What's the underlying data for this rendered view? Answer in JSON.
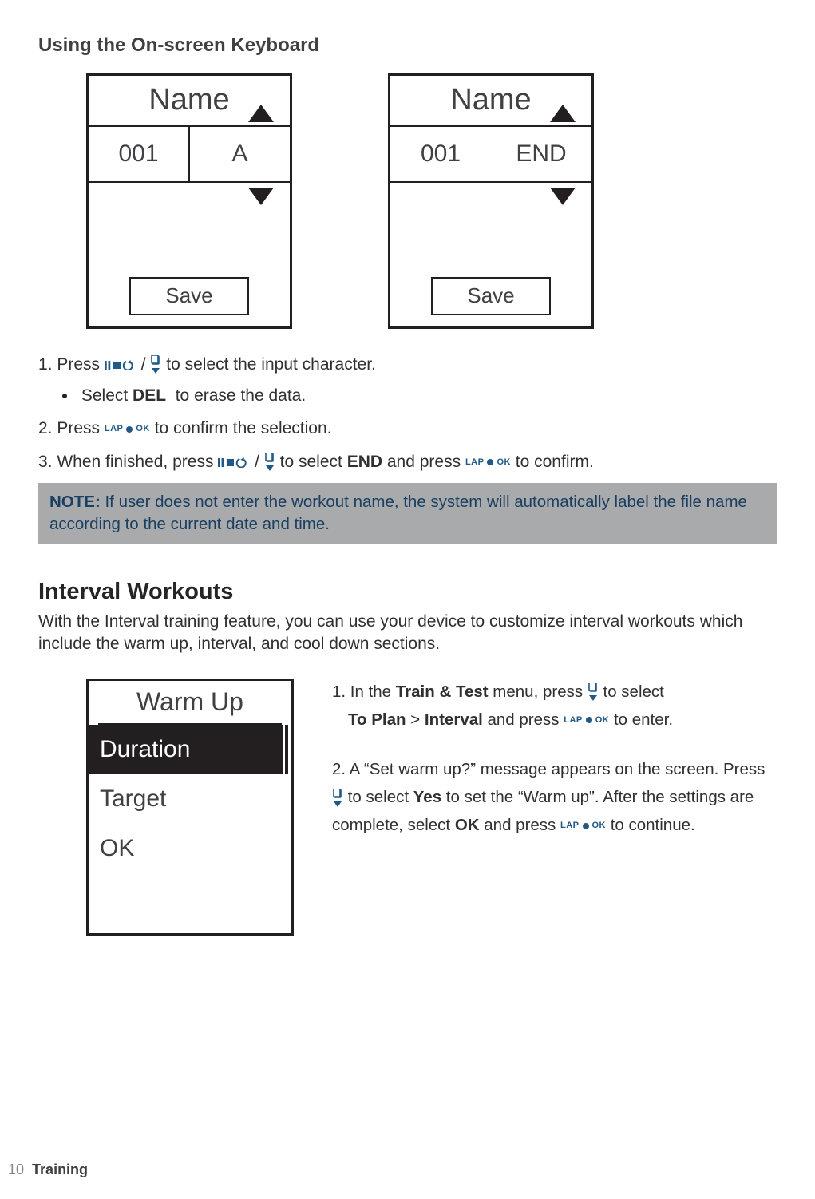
{
  "section1_title": "Using the On-screen Keyboard",
  "screen_a": {
    "title": "Name",
    "value_left": "001",
    "value_right": "A",
    "save": "Save"
  },
  "screen_b": {
    "title": "Name",
    "value_left": "001",
    "value_right": "END",
    "save": "Save"
  },
  "icon_labels": {
    "lap": "LAP",
    "ok": "OK"
  },
  "steps": {
    "s1_a": "1.  Press ",
    "s1_b": " / ",
    "s1_c": "  to select the input character.",
    "s1_sub_a": "Select ",
    "s1_sub_b": "DEL",
    "s1_sub_c": " to erase the data.",
    "s2_a": "2.  Press  ",
    "s2_b": "   to confirm the selection.",
    "s3_a": "3.  When finished, press  ",
    "s3_b": " / ",
    "s3_c": "  to select ",
    "s3_d": "END",
    "s3_e": " and press  ",
    "s3_f": "  to confirm."
  },
  "note": {
    "label": "NOTE:",
    "text": " If user does not enter the workout name, the system will automatically label the file name according to the current date and time."
  },
  "section2_title": "Interval Workouts",
  "section2_intro": "With the Interval training feature, you can use your device to customize interval workouts which include the warm up, interval, and cool down sections.",
  "warmup_screen": {
    "header": "Warm Up",
    "item1": "Duration",
    "item2": "Target",
    "item3": "OK"
  },
  "interval_steps": {
    "i1_a": "1. In the ",
    "i1_b": "Train & Test",
    "i1_c": " menu, press  ",
    "i1_d": "  to select",
    "i1_e": "To Plan",
    "i1_f": " > ",
    "i1_g": "Interval",
    "i1_h": " and press ",
    "i1_i": " to enter.",
    "i2_a": "2. A “Set warm up?” message appears on the screen. Press  ",
    "i2_b": "  to select ",
    "i2_c": "Yes",
    "i2_d": " to set the “Warm up”. After the settings are complete, select ",
    "i2_e": "OK",
    "i2_f": " and press ",
    "i2_g": " to continue."
  },
  "footer": {
    "page": "10",
    "label": "Training"
  }
}
